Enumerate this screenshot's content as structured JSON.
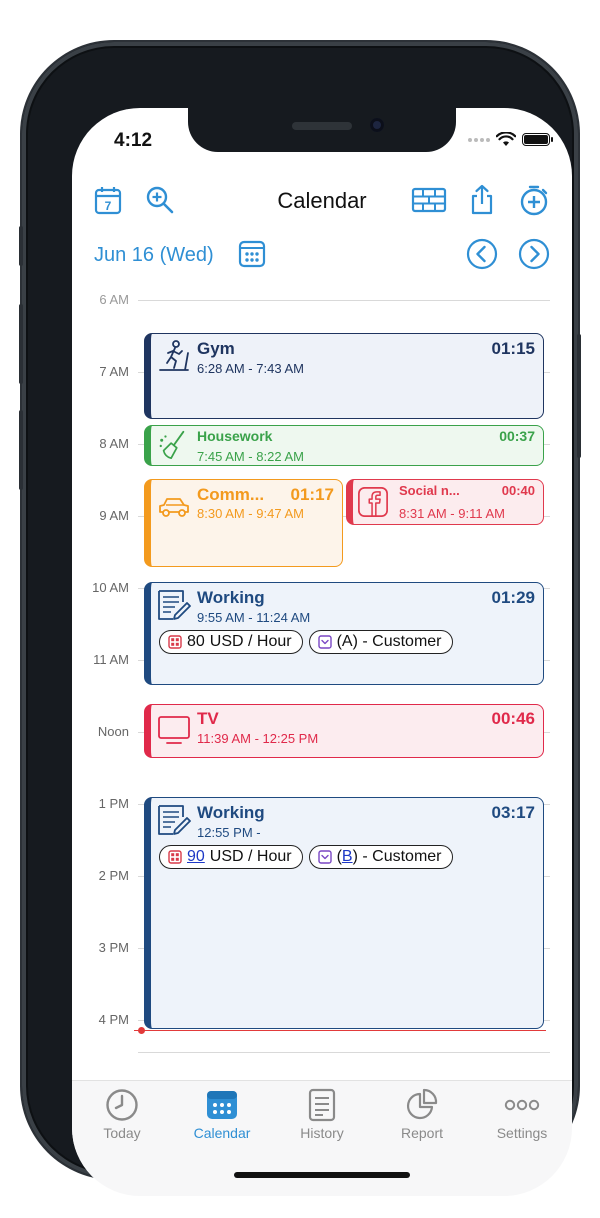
{
  "status": {
    "time": "4:12"
  },
  "toolbar": {
    "title": "Calendar"
  },
  "datebar": {
    "date": "Jun 16 (Wed)"
  },
  "timeline": {
    "hours": [
      "6 AM",
      "7 AM",
      "8 AM",
      "9 AM",
      "10 AM",
      "11 AM",
      "Noon",
      "1 PM",
      "2 PM",
      "3 PM",
      "4 PM"
    ]
  },
  "events": [
    {
      "title": "Gym",
      "time": "6:28 AM - 7:43 AM",
      "duration": "01:15",
      "color": "#1f3560"
    },
    {
      "title": "Housework",
      "time": "7:45 AM - 8:22 AM",
      "duration": "00:37",
      "color": "#3aa24a"
    },
    {
      "title": "Comm...",
      "time": "8:30 AM - 9:47 AM",
      "duration": "01:17",
      "color": "#f39a1e"
    },
    {
      "title": "Social n...",
      "time": "8:31 AM - 9:11 AM",
      "duration": "00:40",
      "color": "#e0394d"
    },
    {
      "title": "Working",
      "time": "9:55 AM - 11:24 AM",
      "duration": "01:29",
      "color": "#1f4a80",
      "rate_amount": "80",
      "rate_unit": "USD / Hour",
      "client_code": "A",
      "client_label": "Customer"
    },
    {
      "title": "TV",
      "time": "11:39 AM - 12:25 PM",
      "duration": "00:46",
      "color": "#e0294a"
    },
    {
      "title": "Working",
      "time": "12:55 PM -",
      "duration": "03:17",
      "color": "#1f4a80",
      "rate_amount": "90",
      "rate_unit": "USD / Hour",
      "client_code": "B",
      "client_label": "Customer"
    }
  ],
  "tabs": [
    {
      "label": "Today"
    },
    {
      "label": "Calendar"
    },
    {
      "label": "History"
    },
    {
      "label": "Report"
    },
    {
      "label": "Settings"
    }
  ]
}
